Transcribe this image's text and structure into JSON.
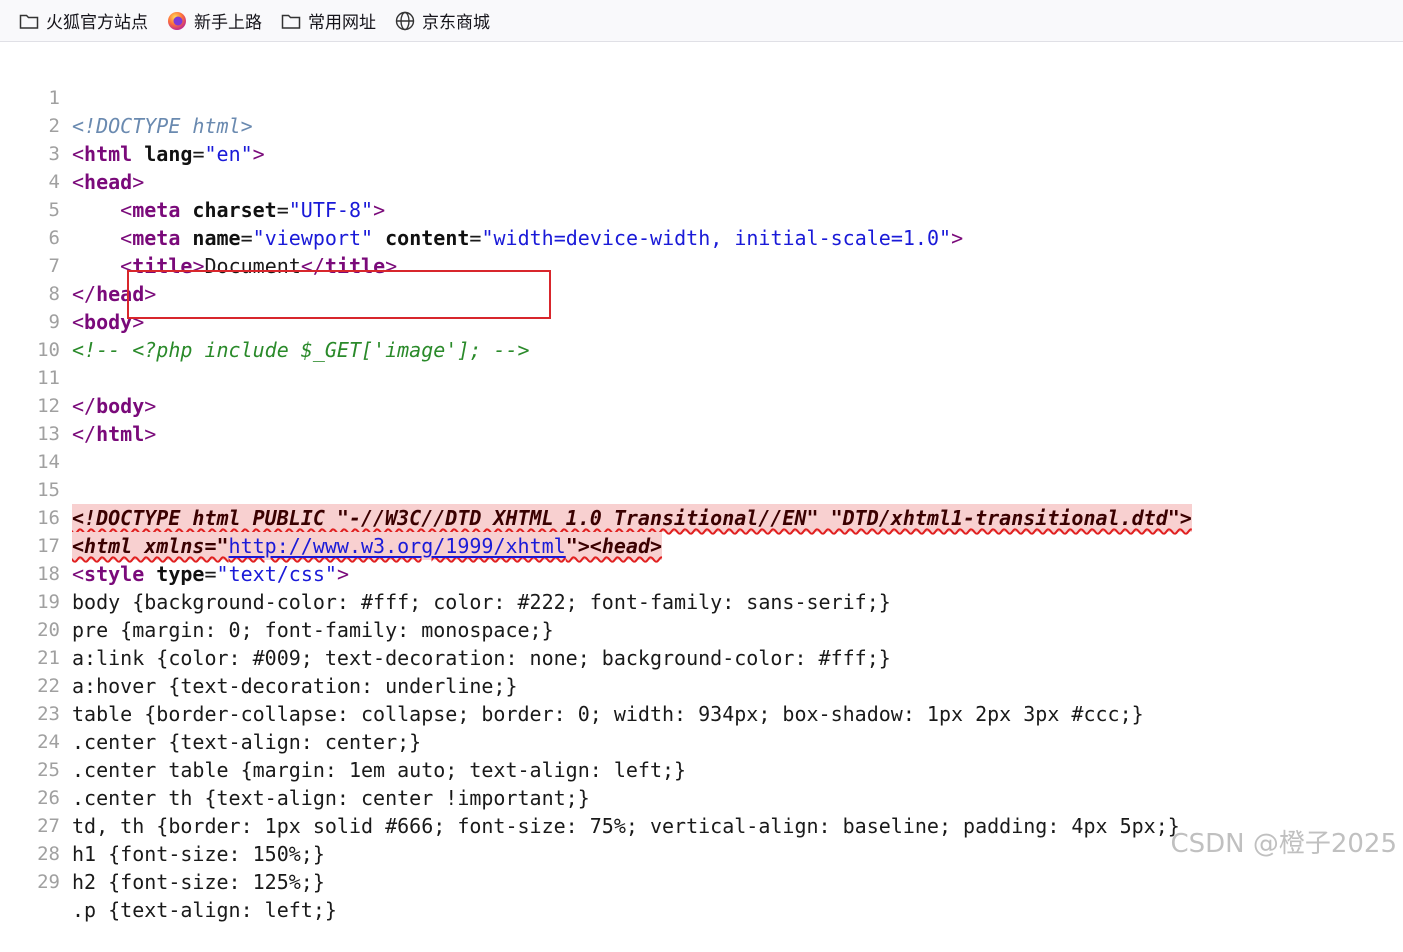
{
  "bookmarks": [
    {
      "label": "火狐官方站点",
      "icon": "folder-icon"
    },
    {
      "label": "新手上路",
      "icon": "firefox-icon"
    },
    {
      "label": "常用网址",
      "icon": "folder-icon"
    },
    {
      "label": "京东商城",
      "icon": "globe-icon"
    }
  ],
  "lines": [
    {
      "n": "1"
    },
    {
      "n": "2"
    },
    {
      "n": "3"
    },
    {
      "n": "4"
    },
    {
      "n": "5"
    },
    {
      "n": "6"
    },
    {
      "n": "7"
    },
    {
      "n": "8"
    },
    {
      "n": "9"
    },
    {
      "n": "10"
    },
    {
      "n": "11"
    },
    {
      "n": "12"
    },
    {
      "n": "13"
    },
    {
      "n": "14"
    },
    {
      "n": "15"
    },
    {
      "n": "16"
    },
    {
      "n": "17"
    },
    {
      "n": "18"
    },
    {
      "n": "19"
    },
    {
      "n": "20"
    },
    {
      "n": "21"
    },
    {
      "n": "22"
    },
    {
      "n": "23"
    },
    {
      "n": "24"
    },
    {
      "n": "25"
    },
    {
      "n": "26"
    },
    {
      "n": "27"
    },
    {
      "n": "28"
    },
    {
      "n": "29"
    }
  ],
  "code": {
    "l1": "<!DOCTYPE html>",
    "l2_open": "<",
    "l2_tag": "html",
    "l2_attr": " lang",
    "l2_eq": "=",
    "l2_val": "\"en\"",
    "l2_close": ">",
    "l3_open": "<",
    "l3_tag": "head",
    "l3_close": ">",
    "l4_indent": "    ",
    "l4_open": "<",
    "l4_tag": "meta",
    "l4_attr": " charset",
    "l4_eq": "=",
    "l4_val": "\"UTF-8\"",
    "l4_close": ">",
    "l5_indent": "    ",
    "l5_open": "<",
    "l5_tag": "meta",
    "l5_attr1": " name",
    "l5_eq1": "=",
    "l5_val1": "\"viewport\"",
    "l5_attr2": " content",
    "l5_eq2": "=",
    "l5_val2": "\"width=device-width, initial-scale=1.0\"",
    "l5_close": ">",
    "l6_indent": "    ",
    "l6_open": "<",
    "l6_tag": "title",
    "l6_close": ">",
    "l6_text": "Document",
    "l6_open2": "</",
    "l6_tag2": "title",
    "l6_close2": ">",
    "l7_open": "</",
    "l7_tag": "head",
    "l7_close": ">",
    "l8_open": "<",
    "l8_tag": "body",
    "l8_close": ">",
    "l9": "<!-- <?php include $_GET['image']; -->",
    "l11_open": "</",
    "l11_tag": "body",
    "l11_close": ">",
    "l12_open": "</",
    "l12_tag": "html",
    "l12_close": ">",
    "l15": "<!DOCTYPE html PUBLIC \"-//W3C//DTD XHTML 1.0 Transitional//EN\" \"DTD/xhtml1-transitional.dtd\">",
    "l16_a": "<html xmlns=\"",
    "l16_link": "http://www.w3.org/1999/xhtml",
    "l16_b": "\"><head>",
    "l17_open": "<",
    "l17_tag": "style",
    "l17_attr": " type",
    "l17_eq": "=",
    "l17_val": "\"text/css\"",
    "l17_close": ">",
    "l18": "body {background-color: #fff; color: #222; font-family: sans-serif;}",
    "l19": "pre {margin: 0; font-family: monospace;}",
    "l20": "a:link {color: #009; text-decoration: none; background-color: #fff;}",
    "l21": "a:hover {text-decoration: underline;}",
    "l22": "table {border-collapse: collapse; border: 0; width: 934px; box-shadow: 1px 2px 3px #ccc;}",
    "l23": ".center {text-align: center;}",
    "l24": ".center table {margin: 1em auto; text-align: left;}",
    "l25": ".center th {text-align: center !important;}",
    "l26": "td, th {border: 1px solid #666; font-size: 75%; vertical-align: baseline; padding: 4px 5px;}",
    "l27": "h1 {font-size: 150%;}",
    "l28": "h2 {font-size: 125%;}",
    "l29": ".p {text-align: left;}"
  },
  "watermark": "CSDN @橙子2025",
  "colors": {
    "highlight_box": "#d8262c",
    "error_bg": "#f8d0d0"
  }
}
